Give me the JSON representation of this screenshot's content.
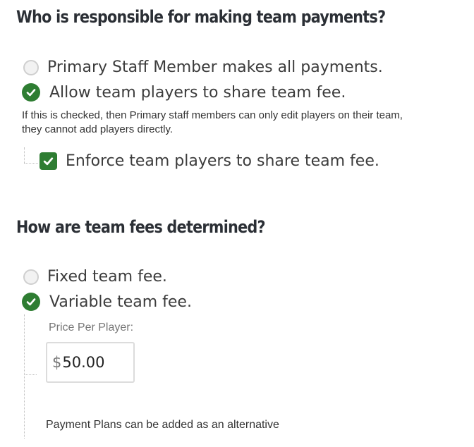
{
  "payments": {
    "heading": "Who is responsible for making team payments?",
    "options": [
      {
        "label": "Primary Staff Member makes all payments.",
        "checked": false
      },
      {
        "label": "Allow team players to share team fee.",
        "checked": true
      }
    ],
    "note_line1": "If this is checked, then Primary staff members can only edit players on their team,",
    "note_line2": "they cannot add players directly.",
    "enforce": {
      "label": "Enforce team players to share team fee.",
      "checked": true
    }
  },
  "fees": {
    "heading": "How are team fees determined?",
    "options": [
      {
        "label": "Fixed team fee.",
        "checked": false
      },
      {
        "label": "Variable team fee.",
        "checked": true
      }
    ],
    "price_label": "Price Per Player:",
    "currency_symbol": "$",
    "price_value": "50.00",
    "footer_note": "Payment Plans can be added as an alternative"
  },
  "colors": {
    "accent": "#2e7d32",
    "radio_off": "#f2f2f2"
  }
}
